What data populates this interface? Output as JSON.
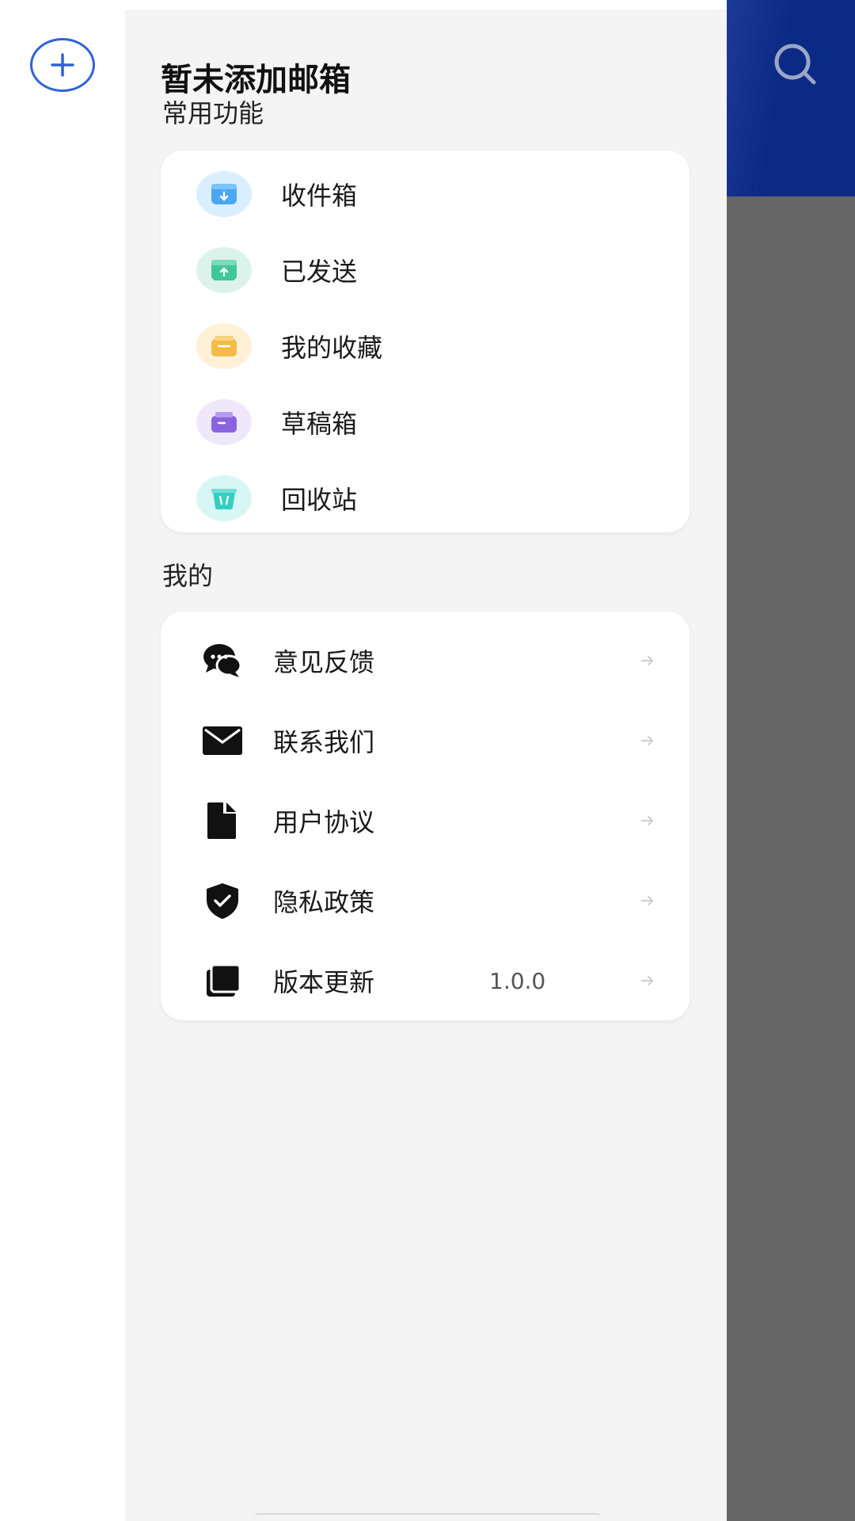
{
  "drawer": {
    "title": "暂未添加邮箱",
    "common_label": "常用功能",
    "mine_label": "我的"
  },
  "folders": [
    {
      "label": "收件箱",
      "icon": "inbox-icon",
      "bg": "#d9efff",
      "fg": "#49a8f2"
    },
    {
      "label": "已发送",
      "icon": "sent-icon",
      "bg": "#dcf3ec",
      "fg": "#3dc79b"
    },
    {
      "label": "我的收藏",
      "icon": "favorites-icon",
      "bg": "#fff1d8",
      "fg": "#f6bb47"
    },
    {
      "label": "草稿箱",
      "icon": "drafts-icon",
      "bg": "#efe8fb",
      "fg": "#8a64e0"
    },
    {
      "label": "回收站",
      "icon": "trash-icon",
      "bg": "#d8f6f4",
      "fg": "#34cfc2"
    }
  ],
  "mine": [
    {
      "label": "意见反馈",
      "icon": "chat-icon",
      "value": ""
    },
    {
      "label": "联系我们",
      "icon": "mail-icon",
      "value": ""
    },
    {
      "label": "用户协议",
      "icon": "document-icon",
      "value": ""
    },
    {
      "label": "隐私政策",
      "icon": "shield-icon",
      "value": ""
    },
    {
      "label": "版本更新",
      "icon": "versions-icon",
      "value": "1.0.0"
    }
  ],
  "colors": {
    "accent": "#2f63d6",
    "header_bg": "#0b2a84",
    "dim": "#666666"
  }
}
